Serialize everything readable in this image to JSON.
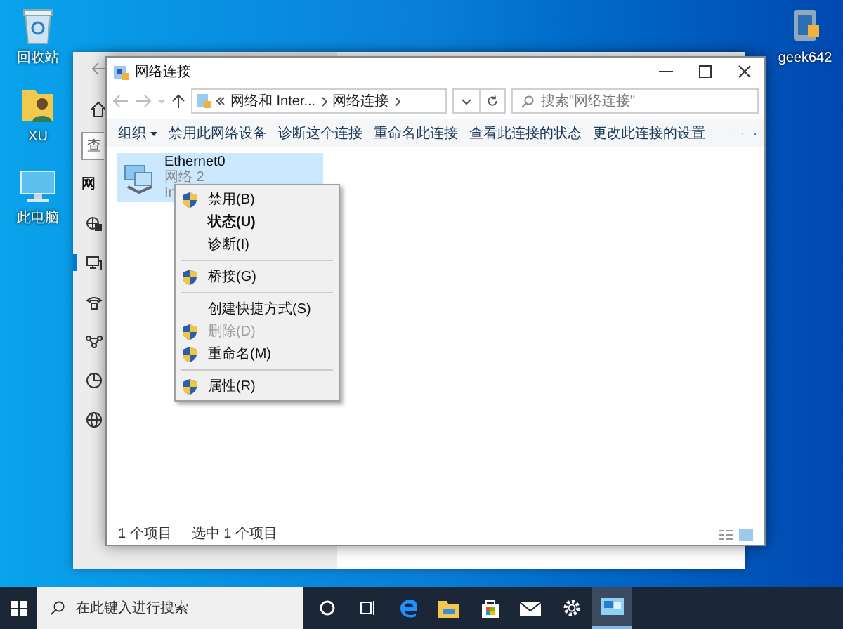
{
  "desktop_icons": [
    {
      "label": "回收站",
      "kind": "recycle"
    },
    {
      "label": "XU",
      "kind": "user"
    },
    {
      "label": "此电脑",
      "kind": "pc"
    },
    {
      "label": "geek642",
      "kind": "app"
    }
  ],
  "settings_window": {
    "search_placeholder": "查",
    "heading": "网",
    "nav_items": [
      {
        "kind": "globe-lock",
        "selected": false
      },
      {
        "kind": "ethernet",
        "selected": true
      },
      {
        "kind": "dialup",
        "selected": false
      },
      {
        "kind": "vpn",
        "selected": false
      },
      {
        "kind": "usage",
        "selected": false
      },
      {
        "kind": "globe",
        "selected": false
      }
    ]
  },
  "explorer": {
    "title": "网络连接",
    "breadcrumb": [
      "网络和 Inter...",
      "网络连接"
    ],
    "search": {
      "placeholder": "搜索\"网络连接\""
    },
    "organize": "组织",
    "commands": [
      "禁用此网络设备",
      "诊断这个连接",
      "重命名此连接",
      "查看此连接的状态",
      "更改此连接的设置"
    ],
    "items": [
      {
        "name": "Ethernet0",
        "line_2": "网络 2",
        "line_3": "In",
        "selected": true
      }
    ],
    "context_menu": [
      {
        "kind": "item",
        "label": "禁用(B)",
        "shield": true,
        "bold": false,
        "disabled": false
      },
      {
        "kind": "item",
        "label": "状态(U)",
        "shield": false,
        "bold": true,
        "disabled": false
      },
      {
        "kind": "item",
        "label": "诊断(I)",
        "shield": false,
        "bold": false,
        "disabled": false
      },
      {
        "kind": "separator"
      },
      {
        "kind": "item",
        "label": "桥接(G)",
        "shield": true,
        "bold": false,
        "disabled": false
      },
      {
        "kind": "separator"
      },
      {
        "kind": "item",
        "label": "创建快捷方式(S)",
        "shield": false,
        "bold": false,
        "disabled": false
      },
      {
        "kind": "item",
        "label": "删除(D)",
        "shield": true,
        "bold": false,
        "disabled": true
      },
      {
        "kind": "item",
        "label": "重命名(M)",
        "shield": true,
        "bold": false,
        "disabled": false
      },
      {
        "kind": "separator"
      },
      {
        "kind": "item",
        "label": "属性(R)",
        "shield": true,
        "bold": false,
        "disabled": false
      }
    ],
    "status": [
      "1 个项目",
      "选中 1 个项目"
    ]
  },
  "taskbar": {
    "search_placeholder": "在此键入进行搜索",
    "apps": [
      {
        "kind": "cortana",
        "active": false
      },
      {
        "kind": "taskview",
        "active": false
      },
      {
        "kind": "edge",
        "active": false
      },
      {
        "kind": "folder",
        "active": false
      },
      {
        "kind": "store",
        "active": false
      },
      {
        "kind": "mail",
        "active": false
      },
      {
        "kind": "settings",
        "active": false
      },
      {
        "kind": "network",
        "active": true
      }
    ]
  }
}
